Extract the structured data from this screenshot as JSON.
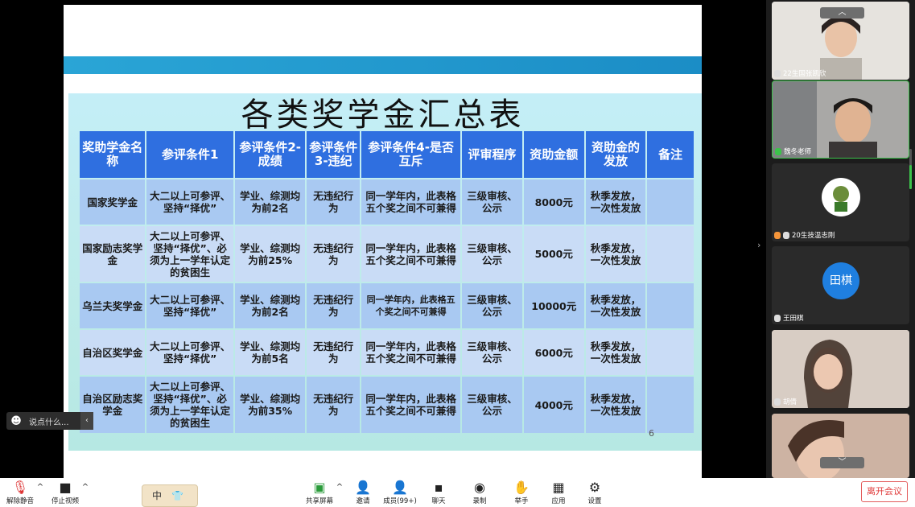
{
  "slide": {
    "title": "各类奖学金汇总表",
    "page_number": "6",
    "headers": [
      "奖助学金名称",
      "参评条件1",
      "参评条件2-成绩",
      "参评条件3-违纪",
      "参评条件4-是否互斥",
      "评审程序",
      "资助金额",
      "资助金的发放",
      "备注"
    ],
    "rows": [
      [
        "国家奖学金",
        "大二以上可参评、坚持“择优”",
        "学业、综测均为前2名",
        "无违纪行为",
        "同一学年内，此表格五个奖之间不可兼得",
        "三级审核、公示",
        "8000元",
        "秋季发放，一次性发放",
        ""
      ],
      [
        "国家励志奖学金",
        "大二以上可参评、坚持“择优”、必须为上一学年认定的贫困生",
        "学业、综测均为前25%",
        "无违纪行为",
        "同一学年内，此表格五个奖之间不可兼得",
        "三级审核、公示",
        "5000元",
        "秋季发放，一次性发放",
        ""
      ],
      [
        "乌兰夫奖学金",
        "大二以上可参评、坚持“择优”",
        "学业、综测均为前2名",
        "无违纪行为",
        "同一学年内，此表格五个奖之间不可兼得",
        "三级审核、公示",
        "10000元",
        "秋季发放，一次性发放",
        ""
      ],
      [
        "自治区奖学金",
        "大二以上可参评、坚持“择优”",
        "学业、综测均为前5名",
        "无违纪行为",
        "同一学年内，此表格五个奖之间不可兼得",
        "三级审核、公示",
        "6000元",
        "秋季发放，一次性发放",
        ""
      ],
      [
        "自治区励志奖学金",
        "大二以上可参评、坚持“择优”、必须为上一学年认定的贫困生",
        "学业、综测均为前35%",
        "无违纪行为",
        "同一学年内，此表格五个奖之间不可兼得",
        "三级审核、公示",
        "4000元",
        "秋季发放，一次性发放",
        ""
      ]
    ]
  },
  "chat": {
    "placeholder": "说点什么..."
  },
  "participants": [
    {
      "name": "22生国张凯欣"
    },
    {
      "name": "魏冬老师"
    },
    {
      "name": "20生技温志刚"
    },
    {
      "name": "王田棋",
      "avatar_text": "田棋"
    },
    {
      "name": "胡倩"
    },
    {
      "name": ""
    }
  ],
  "toolbar": {
    "unmute": "解除静音",
    "stop_video": "停止视频",
    "share": "共享屏幕",
    "invite": "邀请",
    "members": "成员(99+)",
    "chat": "聊天",
    "record": "录制",
    "raise_hand": "举手",
    "apps": "应用",
    "settings": "设置",
    "leave": "离开会议",
    "input_mode": "中"
  },
  "colors": {
    "header": "#2f6fe0",
    "row_dark": "#a9c9f2",
    "row_light": "#c9dcf6",
    "leave": "#e03b3b",
    "accent_green": "#3cc24b"
  }
}
